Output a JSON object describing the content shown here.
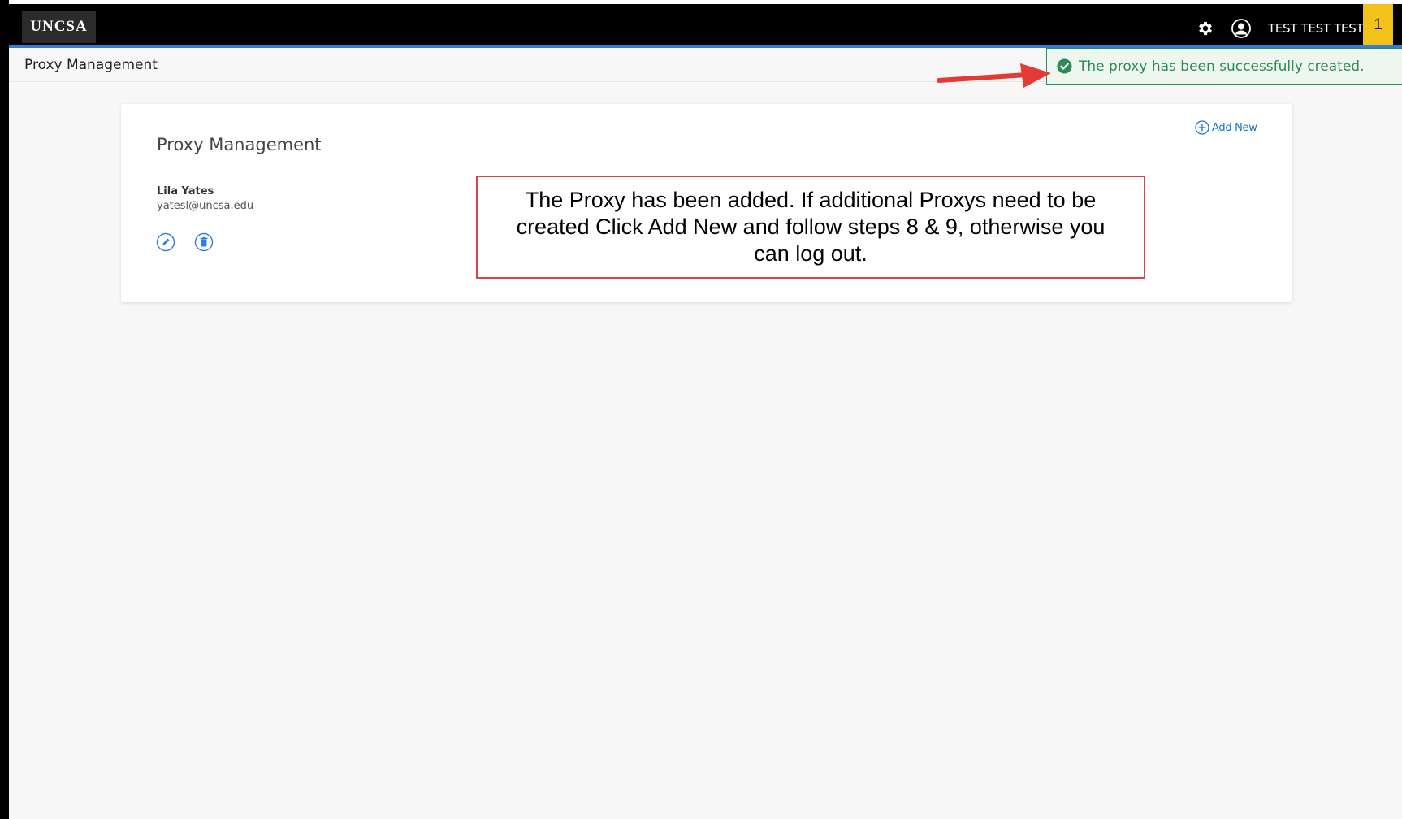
{
  "topbar": {
    "logo_text": "UNCSA",
    "user_name": "TEST TEST TEST",
    "notification_count": "1",
    "gear_icon": "gear-icon",
    "user_icon": "user-circle-icon"
  },
  "page": {
    "header_title": "Proxy Management"
  },
  "toast": {
    "message": "The proxy has been successfully created.",
    "icon": "check-circle-icon",
    "color": "#2e8b57"
  },
  "card": {
    "title": "Proxy Management",
    "add_new_label": "Add New",
    "proxies": [
      {
        "name": "Lila Yates",
        "email": "yatesl@uncsa.edu"
      }
    ]
  },
  "callout": {
    "text": "The Proxy has been added. If additional Proxys need to be created Click Add New and follow steps 8 & 9, otherwise you can log out."
  },
  "colors": {
    "accent_blue": "#2f7fd6",
    "link_blue": "#1a73c9",
    "notification_yellow": "#f2c21b",
    "annotation_red": "#e53935"
  }
}
